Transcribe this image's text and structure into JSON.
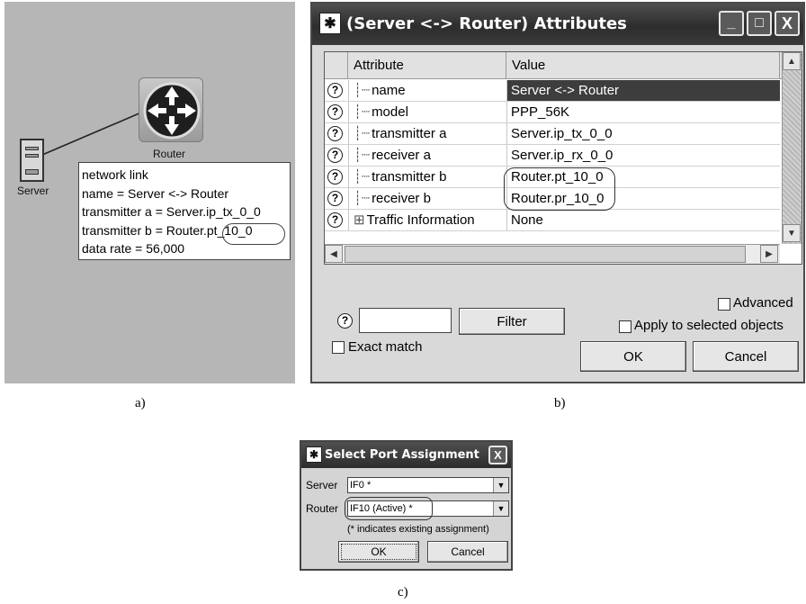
{
  "panel_a": {
    "caption": "a)",
    "router_label": "Router",
    "server_label": "Server",
    "tooltip": [
      "network link",
      "name = Server <-> Router",
      "transmitter a = Server.ip_tx_0_0",
      "transmitter b = Router.pt_10_0",
      "data rate = 56,000"
    ]
  },
  "panel_b": {
    "caption": "b)",
    "title": "(Server <-> Router) Attributes",
    "window_buttons": [
      "_",
      "□",
      "X"
    ],
    "columns": [
      "Attribute",
      "Value"
    ],
    "rows": [
      {
        "attr": "name",
        "value": "Server <-> Router"
      },
      {
        "attr": "model",
        "value": "PPP_56K"
      },
      {
        "attr": "transmitter a",
        "value": "Server.ip_tx_0_0"
      },
      {
        "attr": "receiver a",
        "value": "Server.ip_rx_0_0"
      },
      {
        "attr": "transmitter b",
        "value": "Router.pt_10_0"
      },
      {
        "attr": "receiver b",
        "value": "Router.pr_10_0"
      },
      {
        "attr": "Traffic Information",
        "value": "None"
      }
    ],
    "help_icon": "?",
    "filter_value": "",
    "filter_button": "Filter",
    "exact_match": "Exact match",
    "advanced": "Advanced",
    "apply_selected": "Apply to selected objects",
    "ok": "OK",
    "cancel": "Cancel"
  },
  "panel_c": {
    "caption": "c)",
    "title": "Select Port Assignment",
    "server_label": "Server",
    "server_value": "IF0 *",
    "router_label": "Router",
    "router_value": "IF10 (Active) *",
    "note": "(* indicates existing assignment)",
    "ok": "OK",
    "cancel": "Cancel"
  }
}
